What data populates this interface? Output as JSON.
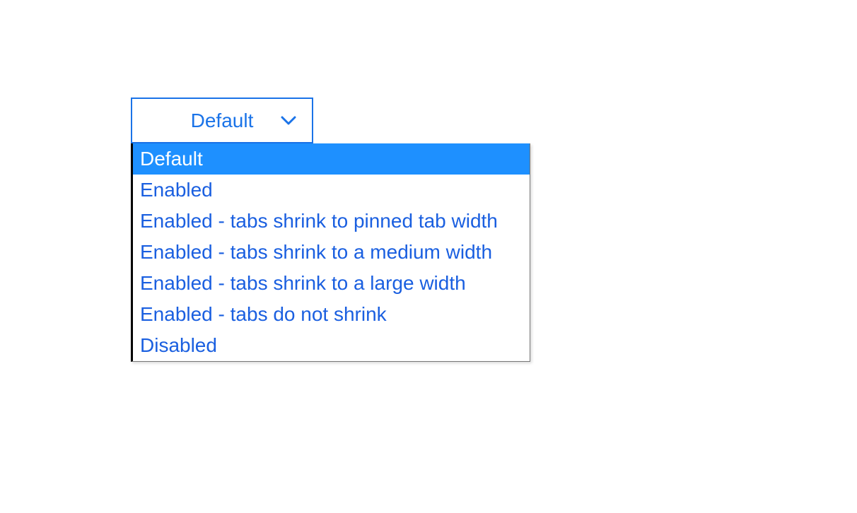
{
  "dropdown": {
    "selected_label": "Default",
    "highlighted_index": 0,
    "options": [
      "Default",
      "Enabled",
      "Enabled - tabs shrink to pinned tab width",
      "Enabled - tabs shrink to a medium width",
      "Enabled - tabs shrink to a large width",
      "Enabled - tabs do not shrink",
      "Disabled"
    ]
  },
  "colors": {
    "accent": "#1a73e8",
    "highlight_bg": "#1e90ff",
    "highlight_text": "#ffffff",
    "option_text": "#1a5fe0"
  }
}
